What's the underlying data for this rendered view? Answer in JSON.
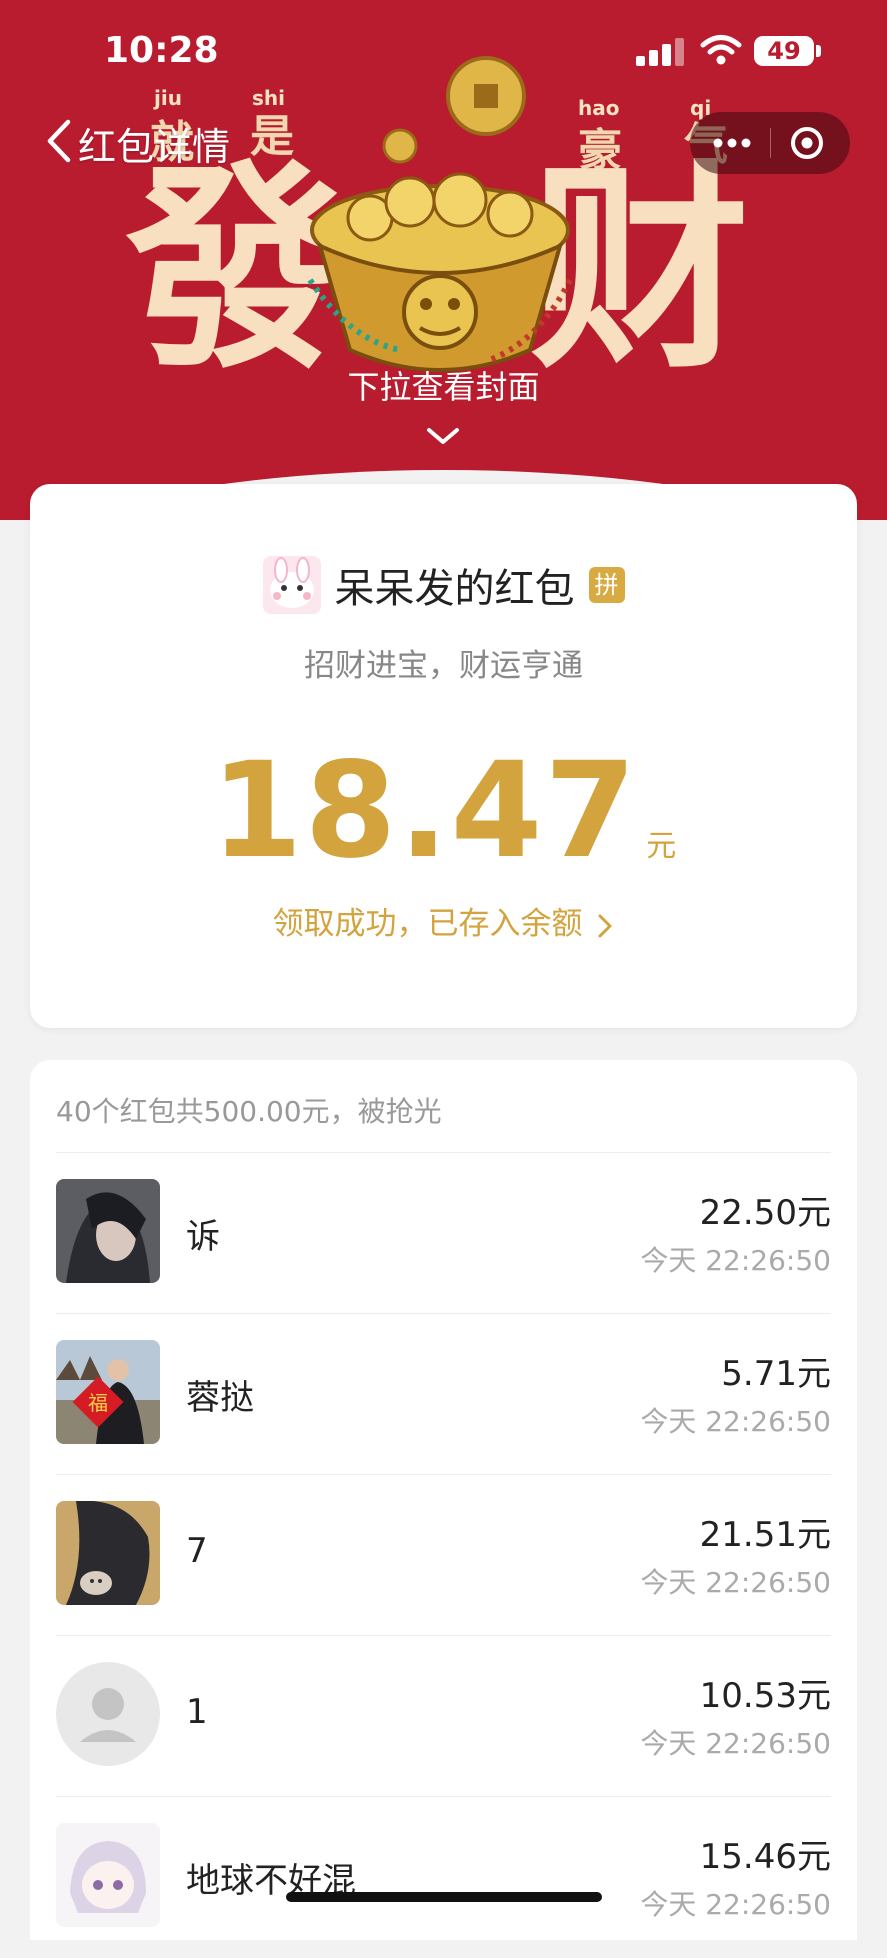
{
  "status_bar": {
    "time": "10:28",
    "battery": "49"
  },
  "nav": {
    "title": "红包详情"
  },
  "cover": {
    "pinyin": [
      "jiu",
      "shi",
      "hao",
      "qi"
    ],
    "small_chars": [
      "就",
      "是",
      "豪",
      "气"
    ],
    "big_chars": [
      "發",
      "财"
    ],
    "pull_hint": "下拉查看封面"
  },
  "packet": {
    "sender": "呆呆发的红包",
    "badge": "拼",
    "blessing": "招财进宝，财运亨通",
    "amount": "18.47",
    "unit": "元",
    "received_text": "领取成功，已存入余额"
  },
  "list": {
    "summary": "40个红包共500.00元，被抢光",
    "rows": [
      {
        "name": "诉",
        "amount": "22.50元",
        "time": "今天 22:26:50",
        "avatar": "dark-hair-avatar"
      },
      {
        "name": "蓉挞",
        "amount": "5.71元",
        "time": "今天 22:26:50",
        "avatar": "fu-photo-avatar"
      },
      {
        "name": "7",
        "amount": "21.51元",
        "time": "今天 22:26:50",
        "avatar": "cat-photo-avatar"
      },
      {
        "name": "1",
        "amount": "10.53元",
        "time": "今天 22:26:50",
        "avatar": "default-avatar"
      },
      {
        "name": "地球不好混",
        "amount": "15.46元",
        "time": "今天 22:26:50",
        "avatar": "anime-avatar"
      }
    ]
  },
  "colors": {
    "header_red": "#b91c2e",
    "gold": "#d3a33e"
  }
}
